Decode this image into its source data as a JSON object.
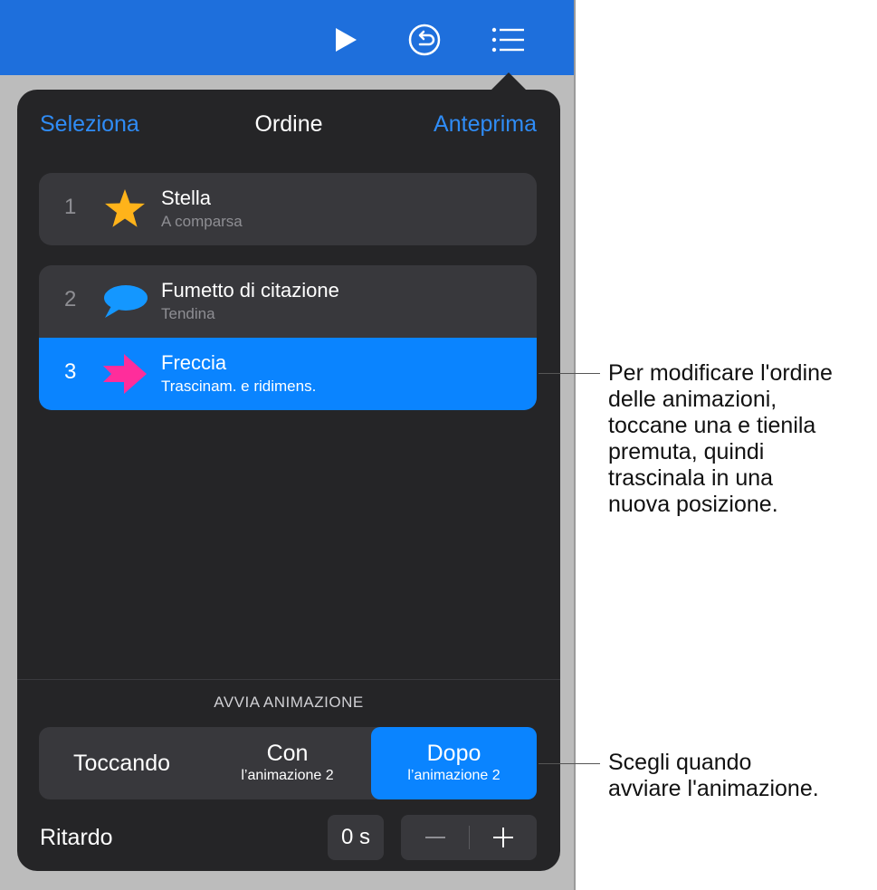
{
  "toolbar": {
    "icons": [
      "play-icon",
      "rewind-icon",
      "list-icon"
    ]
  },
  "popover": {
    "left_action": "Seleziona",
    "title": "Ordine",
    "right_action": "Anteprima"
  },
  "animations": [
    {
      "number": "1",
      "title": "Stella",
      "subtitle": "A comparsa",
      "icon": "star-icon",
      "color": "#ffb31a"
    },
    {
      "number": "2",
      "title": "Fumetto di citazione",
      "subtitle": "Tendina",
      "icon": "speech-bubble-icon",
      "color": "#1497ff"
    },
    {
      "number": "3",
      "title": "Freccia",
      "subtitle": "Trascinam. e ridimens.",
      "icon": "arrow-icon",
      "color": "#ff2d9b",
      "selected": true
    }
  ],
  "start": {
    "label": "AVVIA ANIMAZIONE",
    "options": [
      {
        "main": "Toccando",
        "sub": ""
      },
      {
        "main": "Con",
        "sub": "l’animazione 2"
      },
      {
        "main": "Dopo",
        "sub": "l’animazione 2",
        "selected": true
      }
    ]
  },
  "delay": {
    "label": "Ritardo",
    "value": "0 s",
    "decrement_icon": "minus-icon",
    "increment_icon": "plus-icon"
  },
  "callouts": {
    "reorder": [
      "Per modificare l'ordine",
      "delle animazioni,",
      "toccane una e tienila",
      "premuta, quindi",
      "trascinala in una",
      "nuova posizione."
    ],
    "start": [
      "Scegli quando",
      "avviare l'animazione."
    ]
  },
  "colors": {
    "toolbar": "#1e6fdc",
    "accent": "#0a84ff",
    "link": "#2f8cf6",
    "popover_bg": "#252527"
  }
}
